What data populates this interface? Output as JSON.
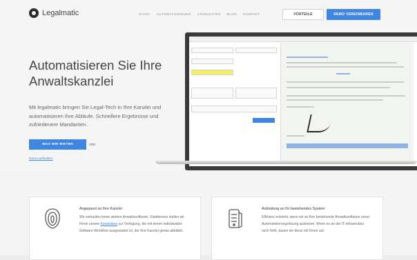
{
  "header": {
    "logo_text": "Legalmatic",
    "nav": [
      "START",
      "AUTOMATISIERUNG",
      "CONSULTING",
      "BLOG",
      "KONTAKT"
    ],
    "login_label": "VORTEILE",
    "cta_label": "DEMO VEREINBAREN"
  },
  "hero": {
    "headline_1": "Automatisieren Sie Ihre",
    "headline_2": "Anwaltskanzlei",
    "description": "Mit legalmatic bringen Sie Legal-Tech in Ihre Kanzlei und automatisieren Ihre Abläufe. Schnellere Ergebnisse und zufriedenere Mandanten.",
    "cta_label": "WAS WIR BIETEN",
    "or_text": "oder",
    "demo_link": "Demo anfordern"
  },
  "features": [
    {
      "title": "Angepasst an Ihre Kanzlei",
      "text_before_link": "Wir verkaufen keine weitere Anwaltssoftware. Stattdessen stellen wir Ihnen unsere ",
      "link_text": "Kanzleibox",
      "text_after_link": " zur Verfügung, die mit einem individuellen Software-Workflow ausgestattet ist, der Ihre Kanzlei genau abbildet.",
      "icon": "fingerprint-icon"
    },
    {
      "title": "Anbindung an Ihr bestehendes System",
      "text": "Effiziens entsteht, wenn wir an Ihre bestehende Anwaltssoftware unser Automatisierungslösung aufsetzen. Wenn es an der IT-Infrastruktur noch fehlt, bauen wir diese mit Ihnen auf.",
      "icon": "server-icon"
    }
  ],
  "colors": {
    "accent": "#3f86e0",
    "background": "#f5f5f5",
    "text": "#444444"
  }
}
